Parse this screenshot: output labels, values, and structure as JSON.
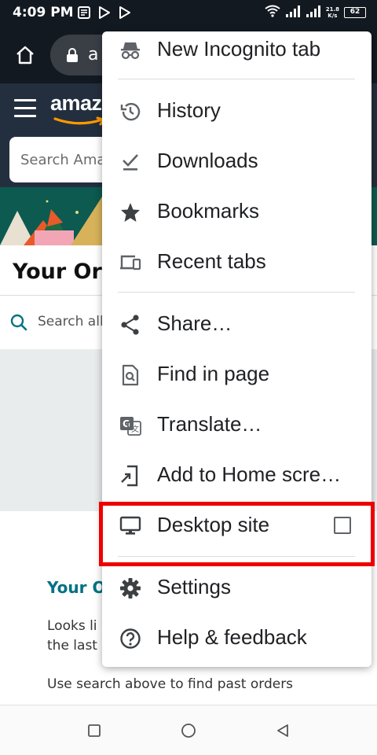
{
  "status_bar": {
    "time": "4:09 PM",
    "net_speed_value": "21.8",
    "net_speed_unit": "K/s",
    "battery": "62"
  },
  "browser": {
    "url_partial": "a"
  },
  "amazon": {
    "logo_partial": "amaz",
    "search_placeholder_partial": "Search Ama",
    "orders_title_partial": "Your Or",
    "order_search_partial": "Search all",
    "your_orders_partial": "Your O",
    "looks_like_line1": "Looks li",
    "looks_like_line2": "the last",
    "use_search_hint": "Use search above to find past orders"
  },
  "menu": {
    "items": [
      {
        "label": "New Incognito tab",
        "icon": "incognito-icon"
      },
      {
        "label": "History",
        "icon": "history-icon"
      },
      {
        "label": "Downloads",
        "icon": "downloads-icon"
      },
      {
        "label": "Bookmarks",
        "icon": "star-icon"
      },
      {
        "label": "Recent tabs",
        "icon": "devices-icon"
      },
      {
        "label": "Share…",
        "icon": "share-icon"
      },
      {
        "label": "Find in page",
        "icon": "find-in-page-icon"
      },
      {
        "label": "Translate…",
        "icon": "translate-icon"
      },
      {
        "label": "Add to Home scre…",
        "icon": "add-to-home-icon"
      },
      {
        "label": "Desktop site",
        "icon": "monitor-icon",
        "checked": false
      },
      {
        "label": "Settings",
        "icon": "gear-icon"
      },
      {
        "label": "Help & feedback",
        "icon": "help-icon"
      }
    ]
  },
  "colors": {
    "header_bg": "#131921",
    "amazon_nav_bg": "#232f3e",
    "link_teal": "#007185",
    "highlight_red": "#ee0000"
  }
}
